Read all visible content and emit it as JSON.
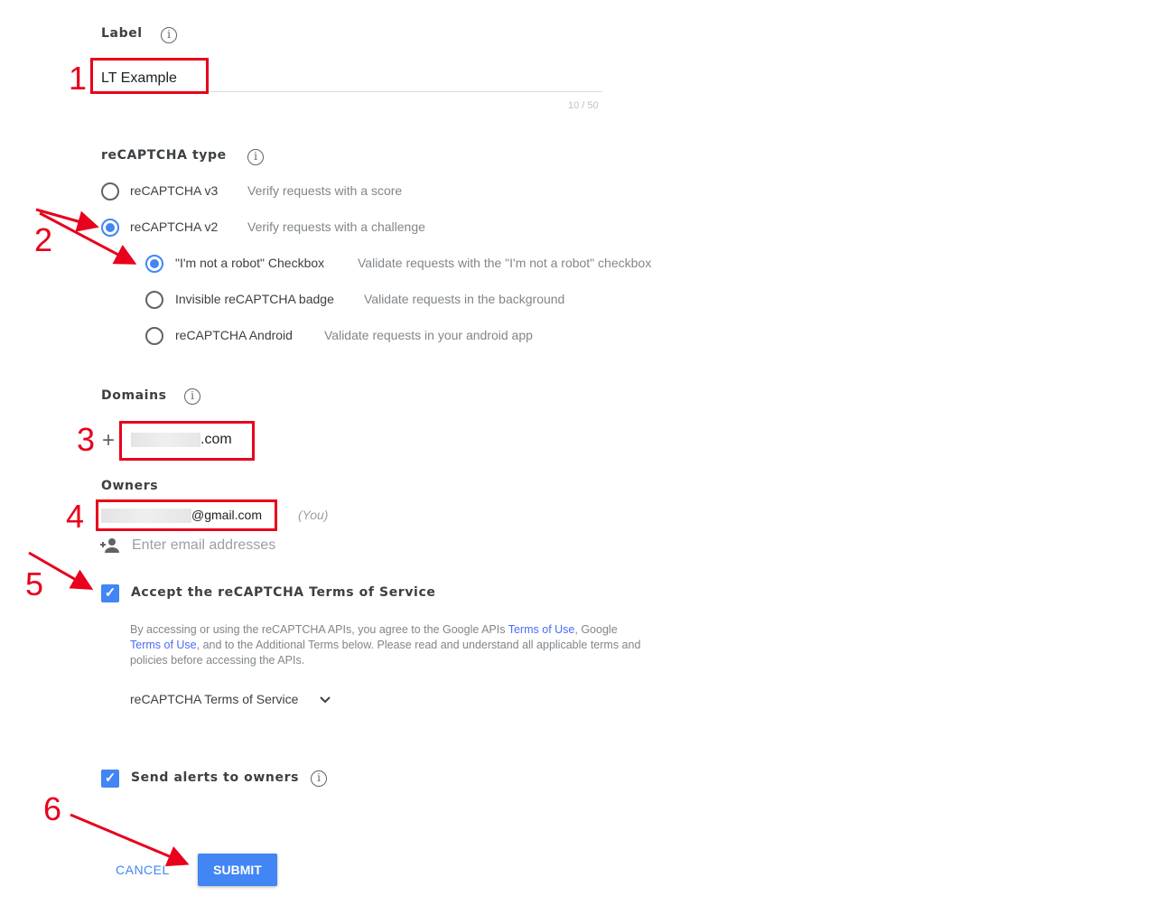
{
  "label_section": {
    "title": "Label",
    "value": "LT Example",
    "counter": "10 / 50"
  },
  "type_section": {
    "title": "reCAPTCHA type",
    "options": [
      {
        "label": "reCAPTCHA v3",
        "desc": "Verify requests with a score",
        "selected": false
      },
      {
        "label": "reCAPTCHA v2",
        "desc": "Verify requests with a challenge",
        "selected": true
      }
    ],
    "sub_options": [
      {
        "label": "\"I'm not a robot\" Checkbox",
        "desc": "Validate requests with the \"I'm not a robot\" checkbox",
        "selected": true
      },
      {
        "label": "Invisible reCAPTCHA badge",
        "desc": "Validate requests in the background",
        "selected": false
      },
      {
        "label": "reCAPTCHA Android",
        "desc": "Validate requests in your android app",
        "selected": false
      }
    ]
  },
  "domains_section": {
    "title": "Domains",
    "add_icon": "+",
    "domain_suffix": ".com"
  },
  "owners_section": {
    "title": "Owners",
    "email_suffix": "@gmail.com",
    "you_label": "(You)",
    "placeholder": "Enter email addresses"
  },
  "tos": {
    "checkbox_label": "Accept the reCAPTCHA Terms of Service",
    "checked": true,
    "text_1": "By accessing or using the reCAPTCHA APIs, you agree to the Google APIs ",
    "link_1": "Terms of Use",
    "text_2": ", Google ",
    "link_2": "Terms of Use",
    "text_3": ", and to the Additional Terms below. Please read and understand all applicable terms and policies before accessing the APIs.",
    "expander": "reCAPTCHA Terms of Service"
  },
  "alerts": {
    "label": "Send alerts to owners",
    "checked": true
  },
  "actions": {
    "cancel": "CANCEL",
    "submit": "SUBMIT"
  },
  "annotations": [
    "1",
    "2",
    "3",
    "4",
    "5",
    "6"
  ],
  "colors": {
    "accent": "#4285f4",
    "annotation": "#e8001c"
  }
}
